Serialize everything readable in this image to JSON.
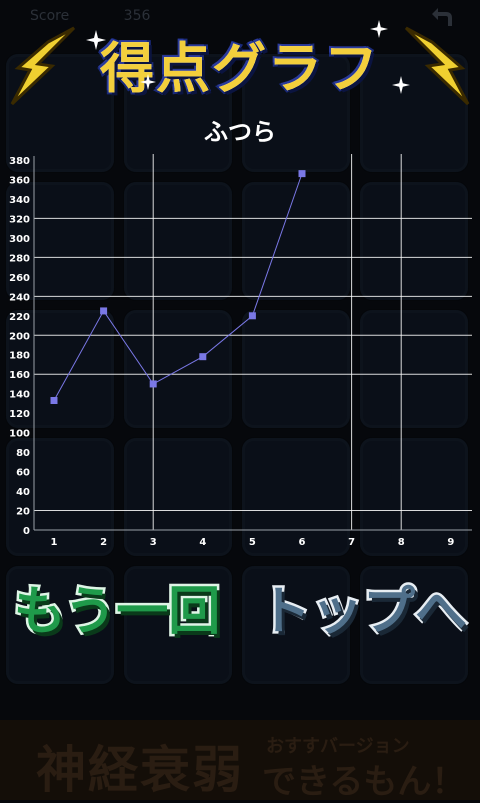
{
  "hud": {
    "score_label": "Score",
    "score_value": "356",
    "back_icon": "return-arrow-icon"
  },
  "header": {
    "title": "得点グラフ",
    "subtitle": "ふつら"
  },
  "colors": {
    "title_fill": "#f3cf3c",
    "title_outline": "#1a2a7a",
    "line": "#7a78e6",
    "grid": "#ffffff",
    "retry_fill": "#1f9a4a",
    "top_fill": "#4f6f8a"
  },
  "chart_data": {
    "type": "line",
    "x": [
      1,
      2,
      3,
      4,
      5,
      6
    ],
    "categories": [
      "1",
      "2",
      "3",
      "4",
      "5",
      "6",
      "7",
      "8",
      "9"
    ],
    "series": [
      {
        "values": [
          133,
          225,
          150,
          178,
          220,
          366
        ]
      }
    ],
    "ylim": [
      0,
      380
    ],
    "xlim": [
      1,
      9
    ],
    "yticks": [
      0,
      20,
      40,
      60,
      80,
      100,
      120,
      140,
      160,
      180,
      200,
      220,
      240,
      260,
      280,
      300,
      320,
      340,
      360,
      380
    ],
    "y_gridlines": [
      20,
      160,
      200,
      240,
      280,
      320
    ],
    "x_gridlines": [
      3,
      7,
      8
    ],
    "grid": true
  },
  "buttons": {
    "retry_label": "もう一回",
    "top_label": "トップへ"
  },
  "ad": {
    "main": "神経衰弱",
    "sub1": "おすすバージョン",
    "sub2": "できるもん！"
  }
}
